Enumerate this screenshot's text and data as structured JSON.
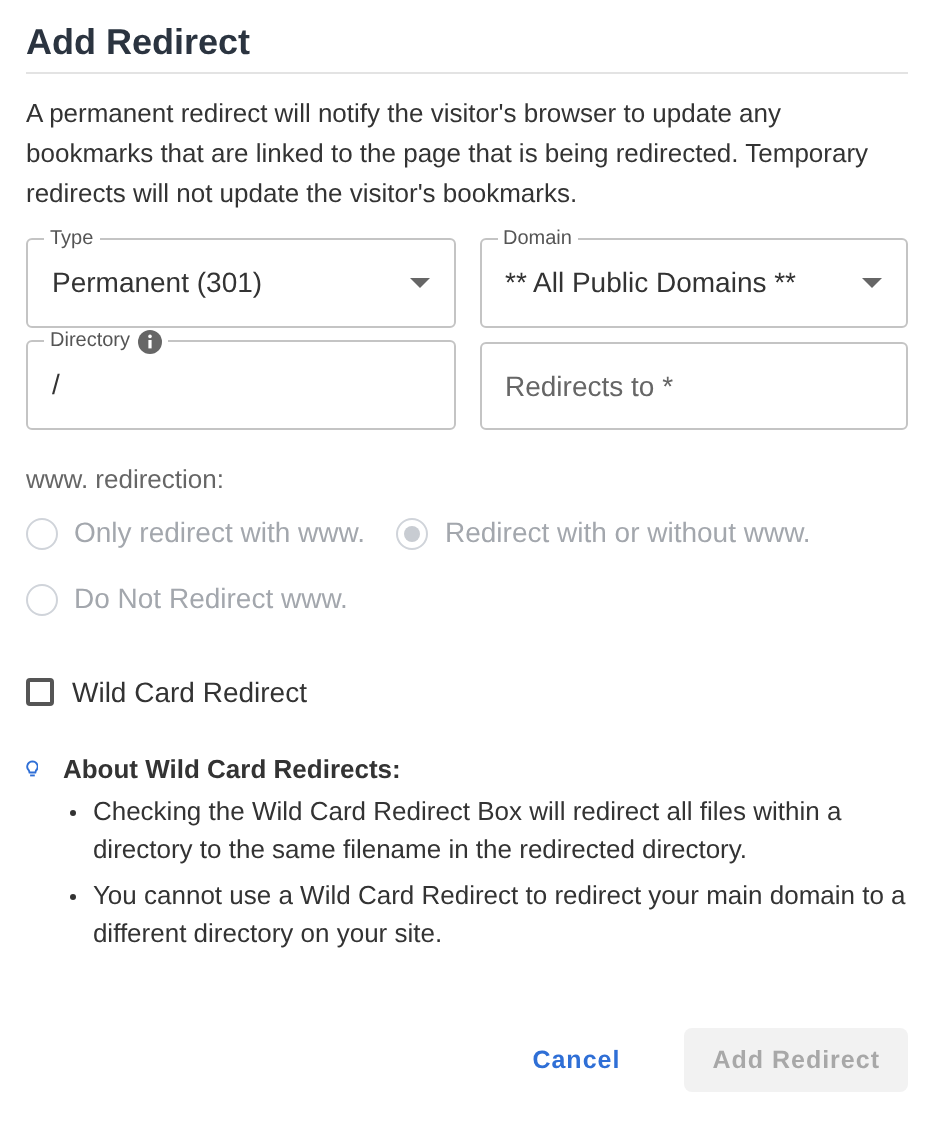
{
  "title": "Add Redirect",
  "description": "A permanent redirect will notify the visitor's browser to update any bookmarks that are linked to the page that is being redirected. Temporary redirects will not update the visitor's bookmarks.",
  "fields": [
    {
      "kind": "select",
      "label": "Type",
      "value": "Permanent (301)"
    },
    {
      "kind": "select",
      "label": "Domain",
      "value": "** All Public Domains **"
    },
    {
      "kind": "text",
      "label": "Directory",
      "value": "/",
      "info": true
    },
    {
      "kind": "text",
      "placeholder": "Redirects to *"
    }
  ],
  "www_redirection": {
    "label": "www. redirection:",
    "disabled": true,
    "options": [
      {
        "label": "Only redirect with www.",
        "selected": false
      },
      {
        "label": "Redirect with or without www.",
        "selected": true
      },
      {
        "label": "Do Not Redirect www.",
        "selected": false
      }
    ]
  },
  "wildcard": {
    "label": "Wild Card Redirect",
    "checked": false
  },
  "about": {
    "title": "About Wild Card Redirects:",
    "items": [
      "Checking the Wild Card Redirect Box will redirect all files within a directory to the same filename in the redirected directory.",
      "You cannot use a Wild Card Redirect to redirect your main domain to a different directory on your site."
    ]
  },
  "buttons": [
    {
      "kind": "link",
      "label": "Cancel",
      "disabled": false
    },
    {
      "kind": "primary",
      "label": "Add Redirect",
      "disabled": true
    }
  ]
}
